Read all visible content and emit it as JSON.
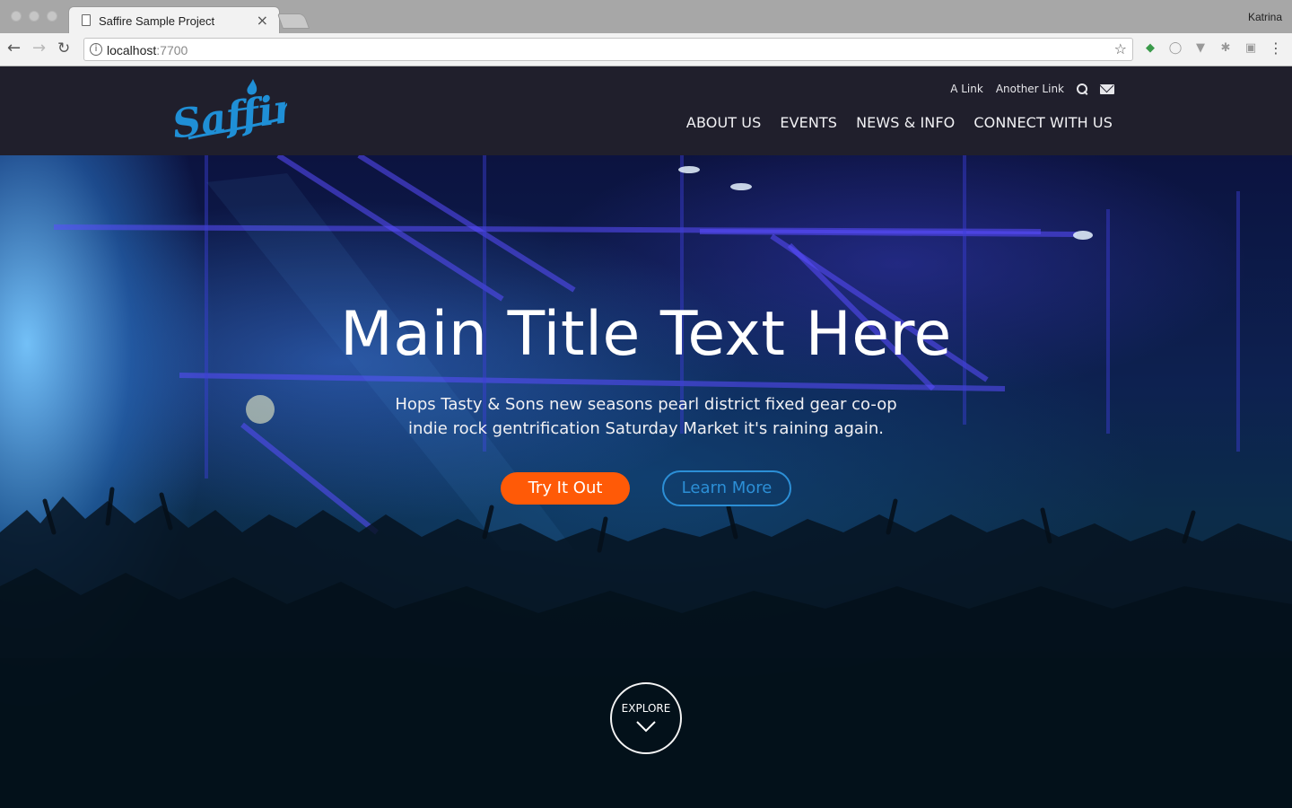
{
  "browser": {
    "tab_title": "Saffire Sample Project",
    "tab_close": "×",
    "profile_name": "Katrina",
    "url_host": "localhost",
    "url_port": ":7700"
  },
  "site": {
    "logo_text": "Saffire",
    "brand_color": "#1f8fd6",
    "utility_links": [
      "A Link",
      "Another Link"
    ],
    "nav": [
      "ABOUT US",
      "EVENTS",
      "NEWS & INFO",
      "CONNECT WITH US"
    ]
  },
  "hero": {
    "title": "Main Title Text Here",
    "subtitle": "Hops Tasty & Sons new seasons pearl district fixed gear co-op indie rock gentrification Saturday Market it's raining again.",
    "primary_button": "Try It Out",
    "primary_color": "#ff5a07",
    "secondary_button": "Learn More",
    "secondary_color": "#2c8fd6",
    "explore_label": "EXPLORE"
  }
}
